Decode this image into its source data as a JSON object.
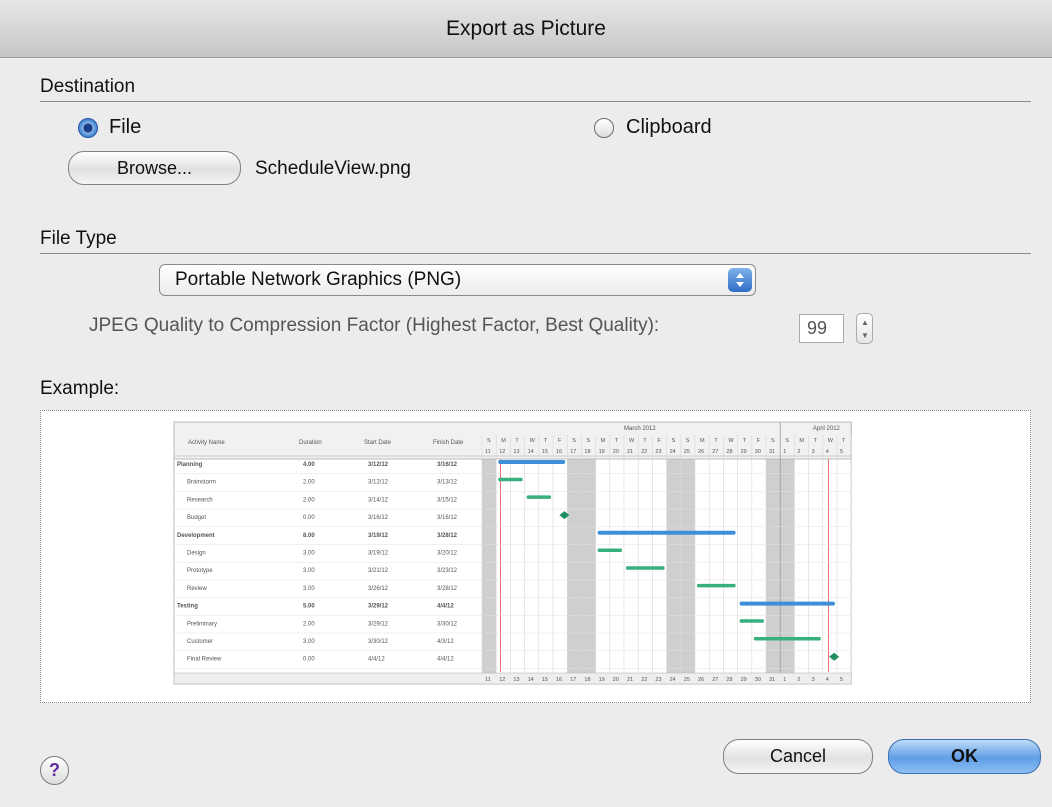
{
  "window": {
    "title": "Export as Picture"
  },
  "destination": {
    "label": "Destination",
    "options": [
      {
        "label": "File",
        "selected": true
      },
      {
        "label": "Clipboard",
        "selected": false
      }
    ],
    "browse_label": "Browse...",
    "filename": "ScheduleView.png"
  },
  "file_type": {
    "label": "File Type",
    "selected": "Portable Network Graphics (PNG)",
    "jpeg_label": "JPEG Quality to Compression Factor (Highest Factor, Best Quality):",
    "jpeg_value": "99"
  },
  "example": {
    "label": "Example:",
    "month_labels": [
      "March 2012",
      "April 2012"
    ],
    "columns": [
      "Activity Name",
      "Duration",
      "Start Date",
      "Finish Date"
    ],
    "rows": [
      {
        "name": "Planning",
        "duration": "4.00",
        "start": "3/12/12",
        "finish": "3/16/12",
        "summary": true
      },
      {
        "name": "Brainstorm",
        "duration": "2.00",
        "start": "3/12/12",
        "finish": "3/13/12",
        "summary": false
      },
      {
        "name": "Research",
        "duration": "2.00",
        "start": "3/14/12",
        "finish": "3/15/12",
        "summary": false
      },
      {
        "name": "Budget",
        "duration": "0.00",
        "start": "3/16/12",
        "finish": "3/16/12",
        "summary": false
      },
      {
        "name": "Development",
        "duration": "8.00",
        "start": "3/19/12",
        "finish": "3/28/12",
        "summary": true
      },
      {
        "name": "Design",
        "duration": "3.00",
        "start": "3/19/12",
        "finish": "3/20/12",
        "summary": false
      },
      {
        "name": "Prototype",
        "duration": "3.00",
        "start": "3/21/12",
        "finish": "3/23/12",
        "summary": false
      },
      {
        "name": "Review",
        "duration": "3.00",
        "start": "3/26/12",
        "finish": "3/28/12",
        "summary": false
      },
      {
        "name": "Testing",
        "duration": "5.00",
        "start": "3/29/12",
        "finish": "4/4/12",
        "summary": true
      },
      {
        "name": "Preliminary",
        "duration": "2.00",
        "start": "3/29/12",
        "finish": "3/30/12",
        "summary": false
      },
      {
        "name": "Customer",
        "duration": "3.00",
        "start": "3/30/12",
        "finish": "4/3/12",
        "summary": false
      },
      {
        "name": "Final Review",
        "duration": "0.00",
        "start": "4/4/12",
        "finish": "4/4/12",
        "summary": false
      }
    ],
    "weekday_letters": [
      "S",
      "M",
      "T",
      "W",
      "T",
      "F",
      "S",
      "S",
      "M",
      "T",
      "W",
      "T",
      "F",
      "S",
      "S",
      "M",
      "T",
      "W",
      "T",
      "F",
      "S",
      "S",
      "M",
      "T",
      "W",
      "T"
    ],
    "day_numbers": [
      "11",
      "12",
      "13",
      "14",
      "15",
      "16",
      "17",
      "18",
      "19",
      "20",
      "21",
      "22",
      "23",
      "24",
      "25",
      "26",
      "27",
      "28",
      "29",
      "30",
      "31",
      "1",
      "2",
      "3",
      "4",
      "5"
    ]
  },
  "buttons": {
    "cancel": "Cancel",
    "ok": "OK",
    "help": "?"
  },
  "colors": {
    "summary_bar": "#3d8fd8",
    "task_bar": "#37b07e",
    "milestone": "#1e8f5e"
  }
}
